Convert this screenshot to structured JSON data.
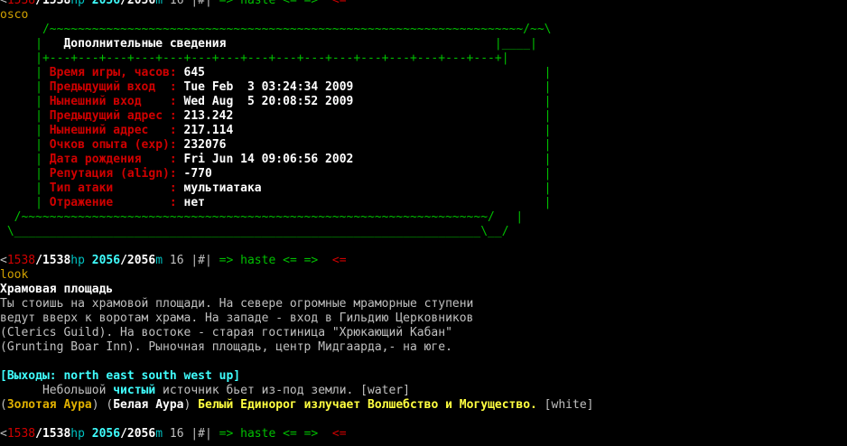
{
  "colors": {
    "background": "#000000",
    "gray": "#c0c0c0",
    "white": "#ffffff",
    "red": "#d00000",
    "bright_red": "#ff3030",
    "green": "#00c000",
    "bright_green": "#40ff40",
    "cyan": "#00c0c0",
    "bright_cyan": "#40ffff",
    "yellow": "#d0a000",
    "bright_yellow": "#ffff40",
    "gold": "#e0b000"
  },
  "lines": [
    {
      "segments": [
        {
          "t": "<",
          "c": "gray"
        },
        {
          "t": "1538",
          "c": "red"
        },
        {
          "t": "/1538",
          "c": "white",
          "b": true
        },
        {
          "t": "hp ",
          "c": "cyan"
        },
        {
          "t": "2056",
          "c": "bright_cyan",
          "b": true
        },
        {
          "t": "/2056",
          "c": "white",
          "b": true
        },
        {
          "t": "m ",
          "c": "cyan"
        },
        {
          "t": "16 ",
          "c": "gray"
        },
        {
          "t": "|#| ",
          "c": "gray"
        },
        {
          "t": "=> haste <= => ",
          "c": "green"
        },
        {
          "t": " <=",
          "c": "red"
        }
      ]
    },
    {
      "segments": [
        {
          "t": "osco",
          "c": "yellow"
        }
      ]
    },
    {
      "segments": [
        {
          "t": "      /~~~~~~~~~~~~~~~~~~~~~~~~~~~~~~~~~~~~~~~~~~~~~~~~~~~~~~~~~~~~~~~~~~~/~~\\",
          "c": "green"
        }
      ]
    },
    {
      "segments": [
        {
          "t": "     |",
          "c": "green"
        },
        {
          "t": "   Дополнительные сведения",
          "c": "white",
          "b": true
        },
        {
          "t": "                                      |____|",
          "c": "green"
        }
      ]
    },
    {
      "segments": [
        {
          "t": "     |+---+---+---+---+---+---+---+---+---+---+---+---+---+---+---+---+|",
          "c": "green"
        }
      ]
    },
    {
      "segments": [
        {
          "t": "     | ",
          "c": "green"
        },
        {
          "t": "Время игры, часов",
          "c": "red",
          "b": true
        },
        {
          "t": ": ",
          "c": "red",
          "b": true
        },
        {
          "t": "645",
          "c": "white",
          "b": true
        },
        {
          "t": "                                                |",
          "c": "green"
        }
      ]
    },
    {
      "segments": [
        {
          "t": "     | ",
          "c": "green"
        },
        {
          "t": "Предыдущий вход  ",
          "c": "red",
          "b": true
        },
        {
          "t": ": ",
          "c": "red",
          "b": true
        },
        {
          "t": "Tue Feb  3 03:24:34 2009",
          "c": "white",
          "b": true
        },
        {
          "t": "                           |",
          "c": "green"
        }
      ]
    },
    {
      "segments": [
        {
          "t": "     | ",
          "c": "green"
        },
        {
          "t": "Нынешний вход    ",
          "c": "red",
          "b": true
        },
        {
          "t": ": ",
          "c": "red",
          "b": true
        },
        {
          "t": "Wed Aug  5 20:08:52 2009",
          "c": "white",
          "b": true
        },
        {
          "t": "                           |",
          "c": "green"
        }
      ]
    },
    {
      "segments": [
        {
          "t": "     | ",
          "c": "green"
        },
        {
          "t": "Предыдущий адрес ",
          "c": "red",
          "b": true
        },
        {
          "t": ": ",
          "c": "red",
          "b": true
        },
        {
          "t": "213.242",
          "c": "white",
          "b": true
        },
        {
          "t": "                                            |",
          "c": "green"
        }
      ]
    },
    {
      "segments": [
        {
          "t": "     | ",
          "c": "green"
        },
        {
          "t": "Нынешний адрес   ",
          "c": "red",
          "b": true
        },
        {
          "t": ": ",
          "c": "red",
          "b": true
        },
        {
          "t": "217.114",
          "c": "white",
          "b": true
        },
        {
          "t": "                                            |",
          "c": "green"
        }
      ]
    },
    {
      "segments": [
        {
          "t": "     | ",
          "c": "green"
        },
        {
          "t": "Очков опыта (exp)",
          "c": "red",
          "b": true
        },
        {
          "t": ": ",
          "c": "red",
          "b": true
        },
        {
          "t": "232076",
          "c": "white",
          "b": true
        },
        {
          "t": "                                             |",
          "c": "green"
        }
      ]
    },
    {
      "segments": [
        {
          "t": "     | ",
          "c": "green"
        },
        {
          "t": "Дата рождения    ",
          "c": "red",
          "b": true
        },
        {
          "t": ": ",
          "c": "red",
          "b": true
        },
        {
          "t": "Fri Jun 14 09:06:56 2002",
          "c": "white",
          "b": true
        },
        {
          "t": "                           |",
          "c": "green"
        }
      ]
    },
    {
      "segments": [
        {
          "t": "     | ",
          "c": "green"
        },
        {
          "t": "Репутация (align)",
          "c": "red",
          "b": true
        },
        {
          "t": ": ",
          "c": "red",
          "b": true
        },
        {
          "t": "-770",
          "c": "white",
          "b": true
        },
        {
          "t": "                                               |",
          "c": "green"
        }
      ]
    },
    {
      "segments": [
        {
          "t": "     | ",
          "c": "green"
        },
        {
          "t": "Тип атаки        ",
          "c": "red",
          "b": true
        },
        {
          "t": ": ",
          "c": "red",
          "b": true
        },
        {
          "t": "мультиатака",
          "c": "white",
          "b": true
        },
        {
          "t": "                                        |",
          "c": "green"
        }
      ]
    },
    {
      "segments": [
        {
          "t": "     | ",
          "c": "green"
        },
        {
          "t": "Отражение        ",
          "c": "red",
          "b": true
        },
        {
          "t": ": ",
          "c": "red",
          "b": true
        },
        {
          "t": "нет",
          "c": "white",
          "b": true
        },
        {
          "t": "                                                |",
          "c": "green"
        }
      ]
    },
    {
      "segments": [
        {
          "t": "  /~~~~~~~~~~~~~~~~~~~~~~~~~~~~~~~~~~~~~~~~~~~~~~~~~~~~~~~~~~~~~~~~~~/   |",
          "c": "green"
        }
      ]
    },
    {
      "segments": [
        {
          "t": " \\__________________________________________________________________\\__/",
          "c": "green"
        }
      ]
    },
    {
      "segments": [
        {
          "t": "",
          "c": "gray"
        }
      ]
    },
    {
      "segments": [
        {
          "t": "<",
          "c": "gray"
        },
        {
          "t": "1538",
          "c": "red"
        },
        {
          "t": "/1538",
          "c": "white",
          "b": true
        },
        {
          "t": "hp ",
          "c": "cyan"
        },
        {
          "t": "2056",
          "c": "bright_cyan",
          "b": true
        },
        {
          "t": "/2056",
          "c": "white",
          "b": true
        },
        {
          "t": "m ",
          "c": "cyan"
        },
        {
          "t": "16 ",
          "c": "gray"
        },
        {
          "t": "|#| ",
          "c": "gray"
        },
        {
          "t": "=> haste <= => ",
          "c": "green"
        },
        {
          "t": " <=",
          "c": "red"
        }
      ]
    },
    {
      "segments": [
        {
          "t": "look",
          "c": "yellow"
        }
      ]
    },
    {
      "segments": [
        {
          "t": "Храмовая площадь",
          "c": "white",
          "b": true
        }
      ]
    },
    {
      "segments": [
        {
          "t": "Ты стоишь на храмовой площади. На севере огромные мраморные ступени",
          "c": "gray"
        }
      ]
    },
    {
      "segments": [
        {
          "t": "ведут вверх к воротам храма. На западе - вход в Гильдию Церковников",
          "c": "gray"
        }
      ]
    },
    {
      "segments": [
        {
          "t": "(Clerics Guild). На востоке - старая гостиница \"Хрюкающий Кабан\"",
          "c": "gray"
        }
      ]
    },
    {
      "segments": [
        {
          "t": "(Grunting Boar Inn). Рыночная площадь, центр Мидгаарда,- на юге.",
          "c": "gray"
        }
      ]
    },
    {
      "segments": [
        {
          "t": "",
          "c": "gray"
        }
      ]
    },
    {
      "segments": [
        {
          "t": "[Выходы: north east south west up]",
          "c": "bright_cyan",
          "b": true
        }
      ]
    },
    {
      "segments": [
        {
          "t": "      Небольшой ",
          "c": "gray"
        },
        {
          "t": "чистый",
          "c": "bright_cyan",
          "b": true
        },
        {
          "t": " источник бьет из-под земли. [water]",
          "c": "gray"
        }
      ]
    },
    {
      "segments": [
        {
          "t": "(",
          "c": "gray"
        },
        {
          "t": "Золотая Аура",
          "c": "gold",
          "b": true
        },
        {
          "t": ") (",
          "c": "gray"
        },
        {
          "t": "Белая Аура",
          "c": "white",
          "b": true
        },
        {
          "t": ") ",
          "c": "gray"
        },
        {
          "t": "Белый Единорог излучает Волшебство и Могущество.",
          "c": "bright_yellow",
          "b": true
        },
        {
          "t": " [white]",
          "c": "gray"
        }
      ]
    },
    {
      "segments": [
        {
          "t": "",
          "c": "gray"
        }
      ]
    },
    {
      "segments": [
        {
          "t": "<",
          "c": "gray"
        },
        {
          "t": "1538",
          "c": "red"
        },
        {
          "t": "/1538",
          "c": "white",
          "b": true
        },
        {
          "t": "hp ",
          "c": "cyan"
        },
        {
          "t": "2056",
          "c": "bright_cyan",
          "b": true
        },
        {
          "t": "/2056",
          "c": "white",
          "b": true
        },
        {
          "t": "m ",
          "c": "cyan"
        },
        {
          "t": "16 ",
          "c": "gray"
        },
        {
          "t": "|#| ",
          "c": "gray"
        },
        {
          "t": "=> haste <= => ",
          "c": "green"
        },
        {
          "t": " <=",
          "c": "red"
        }
      ]
    }
  ]
}
